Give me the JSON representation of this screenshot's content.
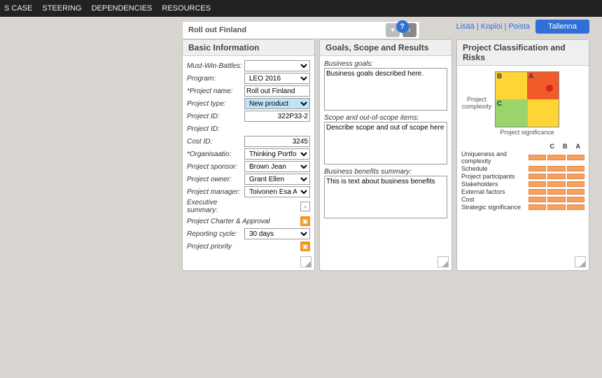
{
  "nav": {
    "case": "S CASE",
    "steering": "STEERING",
    "dependencies": "DEPENDENCIES",
    "resources": "RESOURCES"
  },
  "header": {
    "title": "Roll out Finland"
  },
  "toolbar": {
    "help": "?",
    "links": "Lisää | Kopioi | Poista",
    "save": "Tallenna"
  },
  "panel1": {
    "title": "Basic Information",
    "must_win_label": "Must-Win-Battles:",
    "must_win": "",
    "program_label": "Program:",
    "program": "LEO 2016",
    "project_name_label": "*Project name:",
    "project_name": "Roll out Finland",
    "project_type_label": "Project type:",
    "project_type": "New product",
    "project_id_label": "Project ID:",
    "project_id": "322P33-2",
    "project_id2_label": "Project ID:",
    "cost_id_label": "Cost ID:",
    "cost_id": "3245",
    "org_label": "*Organisaatio:",
    "org": "Thinking Portfolio",
    "sponsor_label": "Project sponsor:",
    "sponsor": "Brown Jean",
    "owner_label": "Project owner:",
    "owner": "Grant Ellen",
    "manager_label": "Project manager:",
    "manager": "Toivonen Esa A",
    "exec_label": "Executive summary:",
    "charter_label": "Project Charter & Approval",
    "cycle_label": "Reporting cycle:",
    "cycle": "30 days",
    "priority_label": "Project priority"
  },
  "panel2": {
    "title": "Goals, Scope and Results",
    "goals_label": "Business goals:",
    "goals": "Business goals described here.",
    "scope_label": "Scope and out-of-scope items:",
    "scope": "Describe scope and out of scope here",
    "benefits_label": "Business benefits summary:",
    "benefits": "This is text about business benefits"
  },
  "panel3": {
    "title": "Project Classification and Risks",
    "ylabel": "Project complexity",
    "xlabel": "Project significance",
    "qB": "B",
    "qA": "A",
    "qC": "C",
    "cols": {
      "c": "C",
      "b": "B",
      "a": "A"
    },
    "rows": {
      "r1": "Uniqueness and complexity",
      "r2": "Schedule",
      "r3": "Project participants",
      "r4": "Stakeholders",
      "r5": "External factors",
      "r6": "Cost",
      "r7": "Strategic significance"
    }
  },
  "chart_data": {
    "type": "scatter",
    "title": "Project Classification",
    "xlabel": "Project significance",
    "ylabel": "Project complexity",
    "quadrants": [
      "C",
      "B",
      "A"
    ],
    "points": [
      {
        "name": "Roll out Finland",
        "quadrant": "A",
        "x": 0.9,
        "y": 0.78
      }
    ],
    "bar_matrix": {
      "columns": [
        "C",
        "B",
        "A"
      ],
      "rows": [
        {
          "label": "Uniqueness and complexity",
          "values": [
            1,
            1,
            1
          ]
        },
        {
          "label": "Schedule",
          "values": [
            1,
            1,
            1
          ]
        },
        {
          "label": "Project participants",
          "values": [
            1,
            1,
            1
          ]
        },
        {
          "label": "Stakeholders",
          "values": [
            1,
            1,
            1
          ]
        },
        {
          "label": "External factors",
          "values": [
            1,
            1,
            1
          ]
        },
        {
          "label": "Cost",
          "values": [
            1,
            1,
            1
          ]
        },
        {
          "label": "Strategic significance",
          "values": [
            1,
            1,
            1
          ]
        }
      ]
    }
  }
}
